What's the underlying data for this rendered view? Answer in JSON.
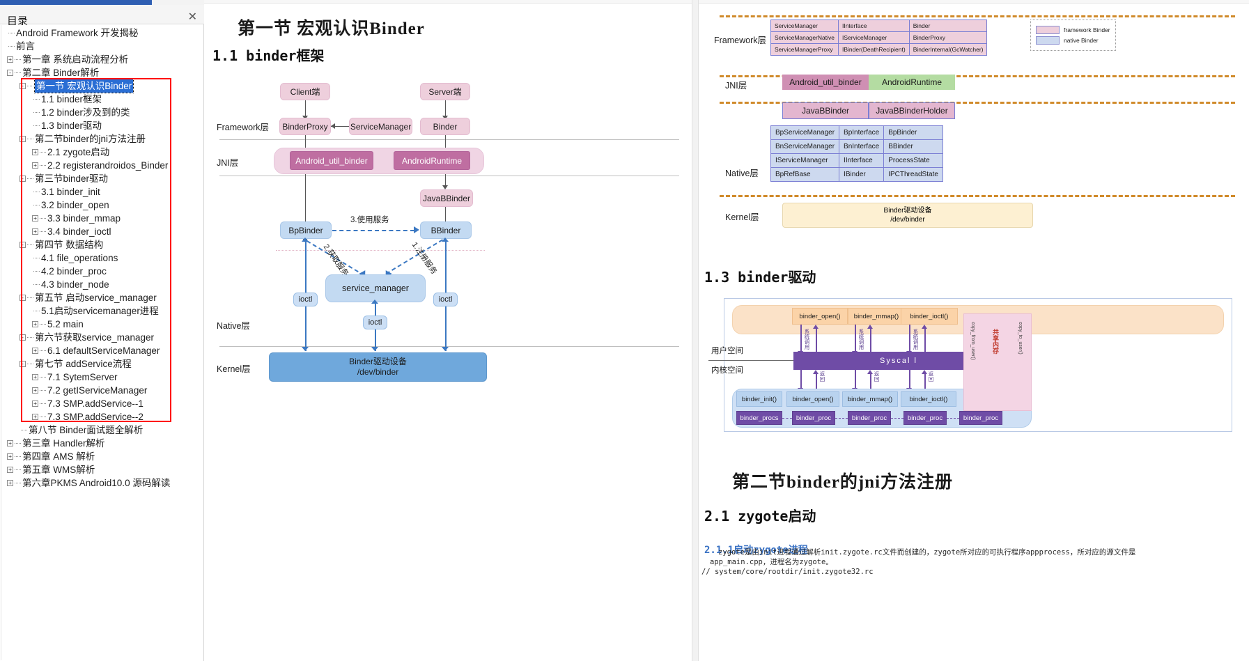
{
  "toc": {
    "title": "目录",
    "close_icon": "close-icon",
    "items": [
      {
        "label": "Android Framework 开发揭秘",
        "depth": 0,
        "twisty": "",
        "selected": false
      },
      {
        "label": "前言",
        "depth": 0,
        "twisty": "",
        "selected": false
      },
      {
        "label": "第一章  系统启动流程分析",
        "depth": 0,
        "twisty": "+",
        "selected": false
      },
      {
        "label": "第二章 Binder解析",
        "depth": 0,
        "twisty": "-",
        "selected": false
      },
      {
        "label": "第一节 宏观认识Binder",
        "depth": 1,
        "twisty": "-",
        "selected": true
      },
      {
        "label": "1.1 binder框架",
        "depth": 2,
        "twisty": "",
        "selected": false
      },
      {
        "label": "1.2 binder涉及到的类",
        "depth": 2,
        "twisty": "",
        "selected": false
      },
      {
        "label": "1.3 binder驱动",
        "depth": 2,
        "twisty": "",
        "selected": false
      },
      {
        "label": "第二节binder的jni方法注册",
        "depth": 1,
        "twisty": "-",
        "selected": false
      },
      {
        "label": "2.1 zygote启动",
        "depth": 2,
        "twisty": "+",
        "selected": false
      },
      {
        "label": "2.2 registerandroidos_Binder",
        "depth": 2,
        "twisty": "+",
        "selected": false
      },
      {
        "label": "第三节binder驱动",
        "depth": 1,
        "twisty": "-",
        "selected": false
      },
      {
        "label": "3.1 binder_init",
        "depth": 2,
        "twisty": "",
        "selected": false
      },
      {
        "label": "3.2 binder_open",
        "depth": 2,
        "twisty": "",
        "selected": false
      },
      {
        "label": "3.3 binder_mmap",
        "depth": 2,
        "twisty": "+",
        "selected": false
      },
      {
        "label": "3.4 binder_ioctl",
        "depth": 2,
        "twisty": "+",
        "selected": false
      },
      {
        "label": "第四节 数据结构",
        "depth": 1,
        "twisty": "-",
        "selected": false
      },
      {
        "label": "4.1 file_operations",
        "depth": 2,
        "twisty": "",
        "selected": false
      },
      {
        "label": "4.2 binder_proc",
        "depth": 2,
        "twisty": "",
        "selected": false
      },
      {
        "label": "4.3 binder_node",
        "depth": 2,
        "twisty": "",
        "selected": false
      },
      {
        "label": "第五节 启动service_manager",
        "depth": 1,
        "twisty": "-",
        "selected": false
      },
      {
        "label": "5.1启动servicemanager进程",
        "depth": 2,
        "twisty": "",
        "selected": false
      },
      {
        "label": "5.2 main",
        "depth": 2,
        "twisty": "+",
        "selected": false
      },
      {
        "label": "第六节获取service_manager",
        "depth": 1,
        "twisty": "-",
        "selected": false
      },
      {
        "label": "6.1 defaultServiceManager",
        "depth": 2,
        "twisty": "+",
        "selected": false
      },
      {
        "label": "第七节 addService流程",
        "depth": 1,
        "twisty": "-",
        "selected": false
      },
      {
        "label": "7.1 SytemServer",
        "depth": 2,
        "twisty": "+",
        "selected": false
      },
      {
        "label": "7.2 getIServiceManager",
        "depth": 2,
        "twisty": "+",
        "selected": false
      },
      {
        "label": "7.3 SMP.addService--1",
        "depth": 2,
        "twisty": "+",
        "selected": false
      },
      {
        "label": "7.3 SMP.addService--2",
        "depth": 2,
        "twisty": "+",
        "selected": false
      },
      {
        "label": "第八节 Binder面试题全解析",
        "depth": 1,
        "twisty": "",
        "selected": false
      },
      {
        "label": "第三章 Handler解析",
        "depth": 0,
        "twisty": "+",
        "selected": false
      },
      {
        "label": "第四章 AMS 解析",
        "depth": 0,
        "twisty": "+",
        "selected": false
      },
      {
        "label": "第五章 WMS解析",
        "depth": 0,
        "twisty": "+",
        "selected": false
      },
      {
        "label": "第六章PKMS Android10.0 源码解读",
        "depth": 0,
        "twisty": "+",
        "selected": false
      }
    ]
  },
  "doc": {
    "left": {
      "section_title": "第一节  宏观认识Binder",
      "sub_title": "1.1 binder框架",
      "diagram": {
        "layers": [
          "Framework层",
          "JNI层",
          "Native层",
          "Kernel层"
        ],
        "nodes": {
          "client": "Client端",
          "server": "Server端",
          "binderproxy": "BinderProxy",
          "servicemanager": "ServiceManager",
          "binder": "Binder",
          "android_util_binder": "Android_util_binder",
          "androidruntime": "AndroidRuntime",
          "javabbinder": "JavaBBinder",
          "bpbinder": "BpBinder",
          "bbinder": "BBinder",
          "service_manager": "service_manager",
          "kernel": "Binder驱动设备\n/dev/binder",
          "kernel_l1": "Binder驱动设备",
          "kernel_l2": "/dev/binder",
          "ioctl": "ioctl"
        },
        "edge_labels": {
          "use": "3.使用服务",
          "get": "2.获取服务",
          "register": "1.注册服务"
        }
      }
    },
    "right": {
      "class_table": {
        "layers": [
          "Framework层",
          "JNI层",
          "Native层",
          "Kernel层"
        ],
        "framework_rows": [
          [
            "ServiceManager",
            "IInterface",
            "Binder"
          ],
          [
            "ServiceManagerNative",
            "IServiceManager",
            "BinderProxy"
          ],
          [
            "ServiceManagerProxy",
            "IBinder(DeathRecipient)",
            "BinderInternal(GcWatcher)"
          ]
        ],
        "jni_items": [
          "Android_util_binder",
          "AndroidRuntime"
        ],
        "jni_items2": [
          "JavaBBinder",
          "JavaBBinderHolder"
        ],
        "native_rows": [
          [
            "BpServiceManager",
            "BpInterface",
            "BpBinder"
          ],
          [
            "BnServiceManager",
            "BnInterface",
            "BBinder"
          ],
          [
            "IServiceManager",
            "IInterface",
            "ProcessState"
          ],
          [
            "BpRefBase",
            "IBinder",
            "IPCThreadState"
          ]
        ],
        "kernel_l1": "Binder驱动设备",
        "kernel_l2": "/dev/binder",
        "legend": [
          {
            "color": "#eecfdc",
            "label": "framework Binder"
          },
          {
            "color": "#cdd9ef",
            "label": "native Binder"
          }
        ]
      },
      "sub_title_13": "1.3 binder驱动",
      "driver_diagram": {
        "user_fns": [
          "binder_open()",
          "binder_mmap()",
          "binder_ioctl()"
        ],
        "kernel_fns": [
          "binder_init()",
          "binder_open()",
          "binder_mmap()",
          "binder_ioctl()"
        ],
        "proc_boxes": [
          "binder_procs",
          "binder_proc",
          "binder_proc",
          "binder_proc",
          "binder_proc"
        ],
        "syscall": "Syscal l",
        "space_labels": [
          "用户空间",
          "内核空间"
        ],
        "arrow_down_label": "系统调用",
        "arrow_up_label": "返回",
        "shm_label": "共享内存",
        "shm_note_left": "copy_from_user()",
        "shm_note_right": "copy_to_user()"
      },
      "section_title_2": "第二节binder的jni方法注册",
      "sub_title_21": "2.1 zygote启动",
      "sub_title_211": "2.1.1启动zygote进程",
      "paragraph_1": "zygote是由init进程通过解析init.zygote.rc文件而创建的，zygote所对应的可执行程序appprocess，所对应的源文件是",
      "paragraph_2": "app_main.cpp，进程名为zygote。",
      "paragraph_3": "// system/core/rootdir/init.zygote32.rc"
    }
  }
}
